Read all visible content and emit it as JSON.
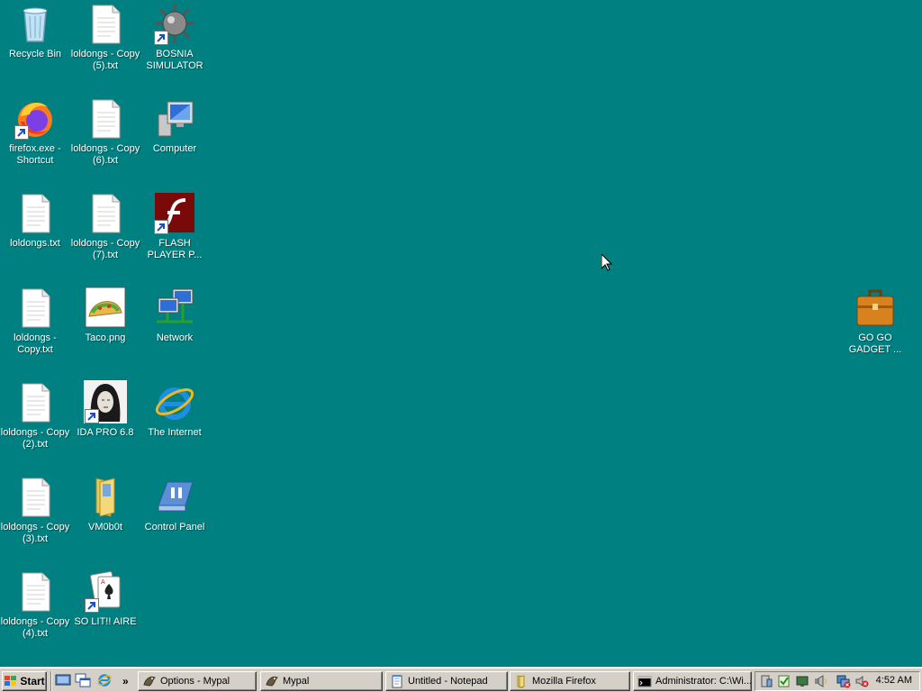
{
  "desktop": {
    "background": "#008080",
    "icons": {
      "recycle_bin": "Recycle Bin",
      "loldongs_copy5": "loldongs - Copy\n(5).txt",
      "bosnia": "BOSNIA\nSIMULATOR",
      "firefox": "firefox.exe -\nShortcut",
      "loldongs_copy6": "loldongs - Copy\n(6).txt",
      "computer": "Computer",
      "loldongs": "loldongs.txt",
      "loldongs_copy7": "loldongs - Copy\n(7).txt",
      "flash": "FLASH\nPLAYER P...",
      "loldongs_copy": "loldongs -\nCopy.txt",
      "taco": "Taco.png",
      "network": "Network",
      "loldongs_copy2": "loldongs - Copy\n(2).txt",
      "ida": "IDA PRO 6.8",
      "internet": "The Internet",
      "loldongs_copy3": "loldongs - Copy\n(3).txt",
      "vm0b0t": "VM0b0t",
      "control_panel": "Control Panel",
      "loldongs_copy4": "loldongs - Copy\n(4).txt",
      "solitaire": "SO LIT!! AIRE",
      "gadget": "GO GO\nGADGET ..."
    }
  },
  "taskbar": {
    "start_label": "Start",
    "quicklaunch_overflow": "»",
    "tasks": {
      "options_mypal": "Options - Mypal",
      "mypal": "Mypal",
      "notepad": "Untitled - Notepad",
      "firefox": "Mozilla Firefox",
      "cmd": "Administrator: C:\\Wi..."
    },
    "clock": "4:52 AM"
  }
}
